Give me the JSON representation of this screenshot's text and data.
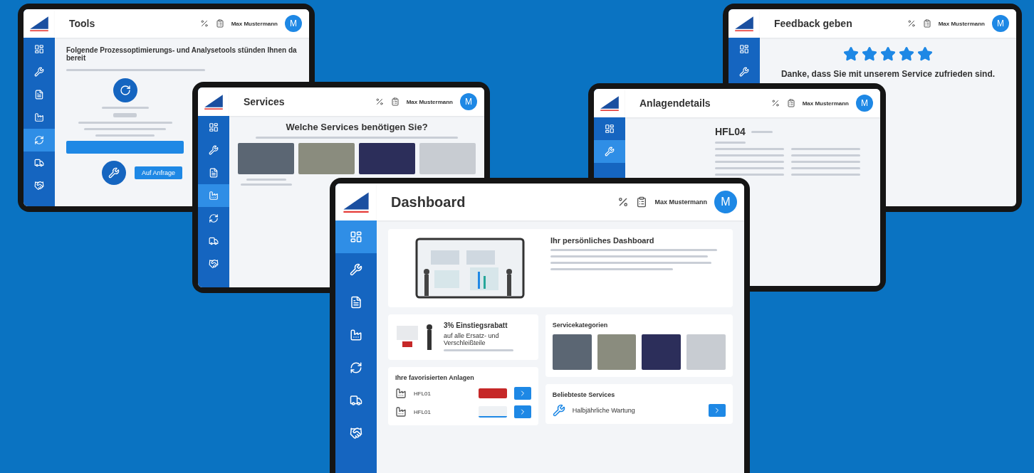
{
  "tablets": [
    {
      "kind": "tools",
      "title": "Tools",
      "user": "Max Mustermann",
      "avatar": "M",
      "nav": [
        {
          "selected": false
        },
        {
          "selected": false
        },
        {
          "selected": false
        },
        {
          "selected": false
        },
        {
          "selected": true
        },
        {
          "selected": false
        },
        {
          "selected": false
        }
      ],
      "heading": "Folgende Prozessoptimierungs- und Analysetools stünden Ihnen da bereit",
      "action": "Auf Anfrage"
    },
    {
      "kind": "feedback",
      "title": "Feedback geben",
      "user": "Max Mustermann",
      "avatar": "M",
      "nav": [
        {
          "selected": false
        },
        {
          "selected": false
        }
      ],
      "stars": 5,
      "heading": "Danke, dass Sie mit unserem Service zufrieden sind."
    },
    {
      "kind": "services",
      "title": "Services",
      "user": "Max Mustermann",
      "avatar": "M",
      "nav": [
        {
          "selected": false
        },
        {
          "selected": false
        },
        {
          "selected": false
        },
        {
          "selected": true
        },
        {
          "selected": false
        },
        {
          "selected": false
        },
        {
          "selected": false
        }
      ],
      "heading": "Welche Services benötigen Sie?"
    },
    {
      "kind": "details",
      "title": "Anlagendetails",
      "user": "Max Mustermann",
      "avatar": "M",
      "nav": [
        {
          "selected": false
        },
        {
          "selected": true
        }
      ],
      "machine": "HFL04"
    },
    {
      "kind": "dashboard",
      "title": "Dashboard",
      "user": "Max Mustermann",
      "avatar": "M",
      "nav": [
        {
          "selected": true
        },
        {
          "selected": false
        },
        {
          "selected": false
        },
        {
          "selected": false
        },
        {
          "selected": false
        },
        {
          "selected": false
        },
        {
          "selected": false
        }
      ],
      "intro_title": "Ihr persönliches Dashboard",
      "promo_title": "3% Einstiegsrabatt",
      "promo_text": "auf alle Ersatz- und Verschleißteile",
      "categories_title": "Servicekategorien",
      "favorites_title": "Ihre favorisierten Anlagen",
      "favorites": [
        {
          "name": "HFL01",
          "overdue": true
        },
        {
          "name": "HFL01",
          "overdue": false
        }
      ],
      "popular_title": "Beliebteste Services",
      "popular": [
        {
          "name": "Halbjährliche Wartung"
        }
      ]
    }
  ]
}
